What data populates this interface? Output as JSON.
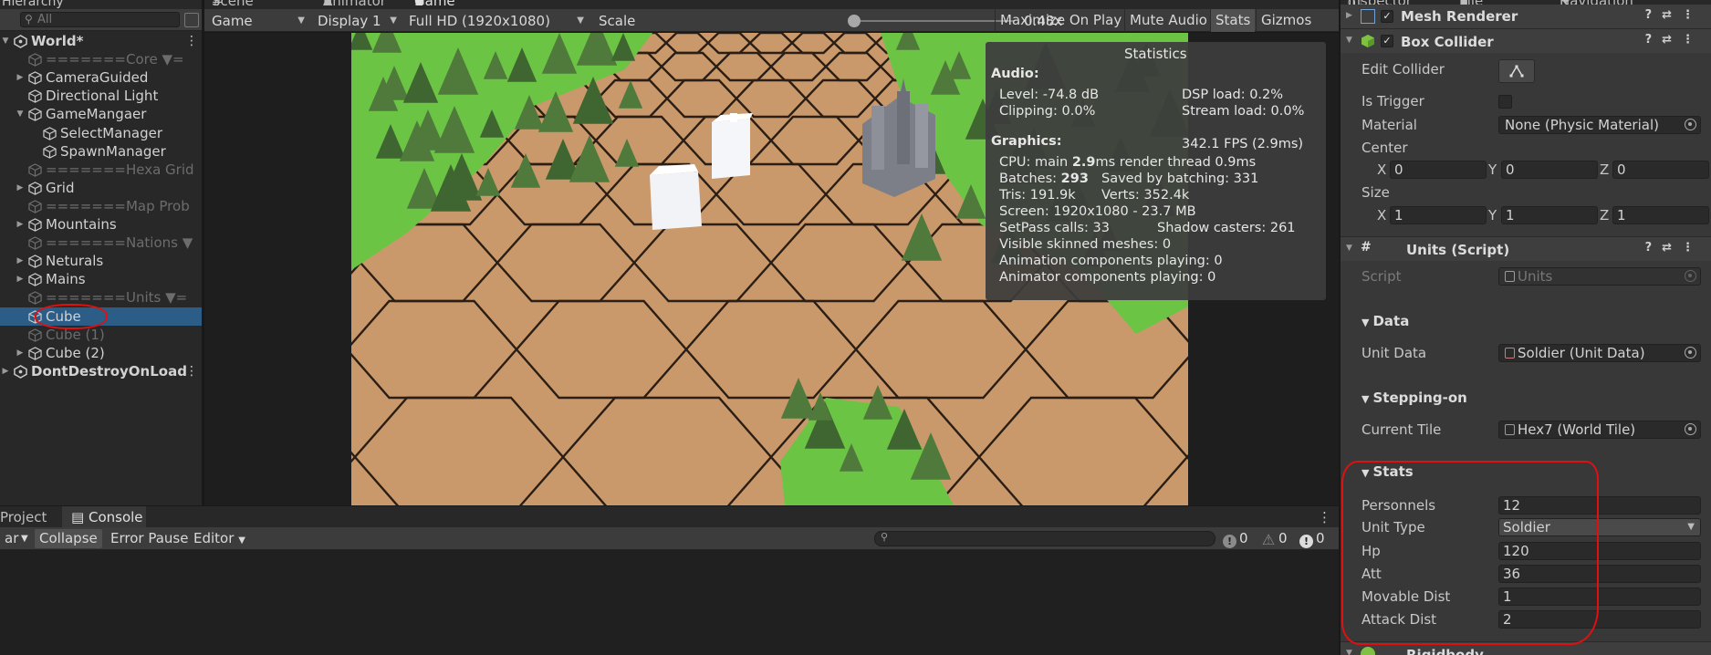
{
  "hierarchy": {
    "tab_label": "Hierarchy",
    "search_placeholder": "All",
    "rows": [
      {
        "label": "World*",
        "indent": 0,
        "expanded": true,
        "scene": true,
        "dim": false,
        "selected": false
      },
      {
        "label": "=======Core ▼=",
        "indent": 1,
        "expanded": null,
        "dim": true
      },
      {
        "label": "CameraGuided",
        "indent": 1,
        "expanded": false,
        "dim": false
      },
      {
        "label": "Directional Light",
        "indent": 1,
        "expanded": null,
        "dim": false
      },
      {
        "label": "GameMangaer",
        "indent": 1,
        "expanded": true,
        "dim": false
      },
      {
        "label": "SelectManager",
        "indent": 2,
        "expanded": null,
        "dim": false
      },
      {
        "label": "SpawnManager",
        "indent": 2,
        "expanded": null,
        "dim": false
      },
      {
        "label": "=======Hexa Grid",
        "indent": 1,
        "expanded": null,
        "dim": true
      },
      {
        "label": "Grid",
        "indent": 1,
        "expanded": false,
        "dim": false
      },
      {
        "label": "=======Map Prob",
        "indent": 1,
        "expanded": null,
        "dim": true
      },
      {
        "label": "Mountains",
        "indent": 1,
        "expanded": false,
        "dim": false
      },
      {
        "label": "=======Nations ▼",
        "indent": 1,
        "expanded": null,
        "dim": true
      },
      {
        "label": "Neturals",
        "indent": 1,
        "expanded": false,
        "dim": false
      },
      {
        "label": "Mains",
        "indent": 1,
        "expanded": false,
        "dim": false
      },
      {
        "label": "=======Units ▼=",
        "indent": 1,
        "expanded": null,
        "dim": true
      },
      {
        "label": "Cube",
        "indent": 1,
        "expanded": null,
        "dim": false,
        "selected": true
      },
      {
        "label": "Cube (1)",
        "indent": 1,
        "expanded": null,
        "dim": true
      },
      {
        "label": "Cube (2)",
        "indent": 1,
        "expanded": false,
        "dim": false
      },
      {
        "label": "DontDestroyOnLoad",
        "indent": 0,
        "expanded": false,
        "scene": true,
        "dim": false
      }
    ]
  },
  "game": {
    "tabs": [
      "Scene",
      "Animator",
      "Game"
    ],
    "mode": "Game",
    "display": "Display 1",
    "resolution": "Full HD (1920x1080)",
    "scale_label": "Scale",
    "scale_value": "0.48x",
    "scale_fraction": 0.03,
    "maximize_on_play": "Maximize On Play",
    "mute_audio": "Mute Audio",
    "stats_btn": "Stats",
    "gizmos_btn": "Gizmos"
  },
  "statistics": {
    "title": "Statistics",
    "audio_header": "Audio:",
    "level": "Level: -74.8 dB",
    "clipping": "Clipping: 0.0%",
    "dsp_load": "DSP load: 0.2%",
    "stream_load": "Stream load: 0.0%",
    "graphics_header": "Graphics:",
    "fps": "342.1 FPS (2.9ms)",
    "cpu_prefix": "CPU: main ",
    "cpu_main": "2.9",
    "cpu_suffix": "ms  render thread 0.9ms",
    "batches_prefix": "Batches: ",
    "batches": "293",
    "saved_batching": "Saved by batching: 331",
    "tris": "Tris: 191.9k",
    "verts": "Verts: 352.4k",
    "screen": "Screen: 1920x1080 - 23.7 MB",
    "setpass": "SetPass calls: 33",
    "shadow_casters": "Shadow casters: 261",
    "skinned": "Visible skinned meshes: 0",
    "animation": "Animation components playing: 0",
    "animator": "Animator components playing: 0"
  },
  "console": {
    "tabs": [
      "Project",
      "Console"
    ],
    "clear_fragment": "ar",
    "collapse": "Collapse",
    "error_pause": "Error Pause",
    "editor": "Editor",
    "info_count": "0",
    "warn_count": "0",
    "error_count": "0"
  },
  "inspector": {
    "tabs": [
      "Inspector",
      "Tile Palette",
      "Navigation"
    ],
    "mesh_renderer": "Mesh Renderer",
    "box_collider": {
      "title": "Box Collider",
      "edit_collider": "Edit Collider",
      "is_trigger": "Is Trigger",
      "material_label": "Material",
      "material_value": "None (Physic Material)",
      "center_label": "Center",
      "center": {
        "x": "0",
        "y": "0",
        "z": "0"
      },
      "size_label": "Size",
      "size": {
        "x": "1",
        "y": "1",
        "z": "1"
      }
    },
    "units_script": {
      "title": "Units (Script)",
      "script_label": "Script",
      "script_value": "Units",
      "data_section": "Data",
      "unit_data_label": "Unit Data",
      "unit_data_value": "Soldier (Unit Data)",
      "stepping_section": "Stepping-on",
      "current_tile_label": "Current Tile",
      "current_tile_value": "Hex7 (World Tile)",
      "stats_section": "Stats",
      "personnels_label": "Personnels",
      "personnels": "12",
      "unit_type_label": "Unit Type",
      "unit_type": "Soldier",
      "hp_label": "Hp",
      "hp": "120",
      "att_label": "Att",
      "att": "36",
      "movable_label": "Movable Dist",
      "movable": "1",
      "attack_label": "Attack Dist",
      "attack": "2"
    },
    "rigidbody": "Rigidbody"
  },
  "colors": {
    "selection": "#2c5d87",
    "annotation_red": "#e01010",
    "hex_tile": "#c9996b",
    "grass": "#6cc444",
    "tree": "#4f7a3c"
  }
}
